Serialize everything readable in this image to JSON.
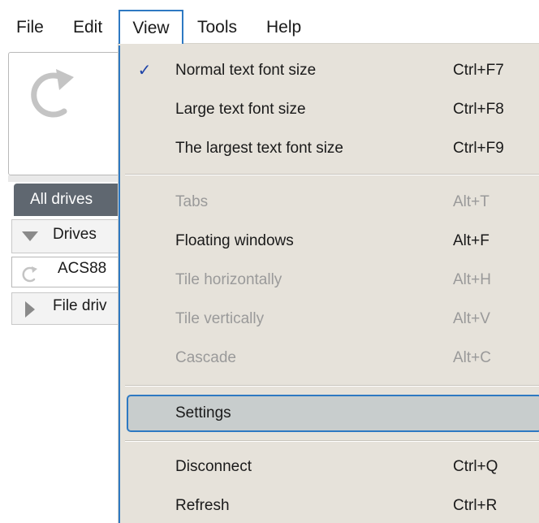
{
  "menubar": {
    "file": "File",
    "edit": "Edit",
    "view": "View",
    "tools": "Tools",
    "help": "Help"
  },
  "left_panel": {
    "tab_label": "All drives",
    "tree": [
      {
        "label": "Drives",
        "icon": "triangle-down-icon"
      },
      {
        "label": "ACS88",
        "icon": "refresh-icon"
      },
      {
        "label": "File driv",
        "icon": "triangle-right-icon"
      }
    ],
    "toolbar_icon": "refresh-icon"
  },
  "view_menu": {
    "items": [
      {
        "label": "Normal text font size",
        "shortcut": "Ctrl+F7",
        "checked": true,
        "enabled": true
      },
      {
        "label": "Large text font size",
        "shortcut": "Ctrl+F8",
        "checked": false,
        "enabled": true
      },
      {
        "label": "The largest text font size",
        "shortcut": "Ctrl+F9",
        "checked": false,
        "enabled": true
      },
      {
        "label": "Tabs",
        "shortcut": "Alt+T",
        "checked": false,
        "enabled": false
      },
      {
        "label": "Floating windows",
        "shortcut": "Alt+F",
        "checked": false,
        "enabled": true
      },
      {
        "label": "Tile horizontally",
        "shortcut": "Alt+H",
        "checked": false,
        "enabled": false
      },
      {
        "label": "Tile vertically",
        "shortcut": "Alt+V",
        "checked": false,
        "enabled": false
      },
      {
        "label": "Cascade",
        "shortcut": "Alt+C",
        "checked": false,
        "enabled": false
      },
      {
        "label": "Settings",
        "shortcut": "",
        "checked": false,
        "enabled": true,
        "highlighted": true
      },
      {
        "label": "Disconnect",
        "shortcut": "Ctrl+Q",
        "checked": false,
        "enabled": true
      },
      {
        "label": "Refresh",
        "shortcut": "Ctrl+R",
        "checked": false,
        "enabled": true
      }
    ],
    "check_glyph": "✓"
  },
  "colors": {
    "accent": "#2e79c2",
    "menu_bg": "#e6e2da",
    "highlight_bg": "#c8cdcd",
    "tab_bg": "#5f6770",
    "check": "#1f44a8",
    "disabled_text": "#9a9a9a"
  }
}
